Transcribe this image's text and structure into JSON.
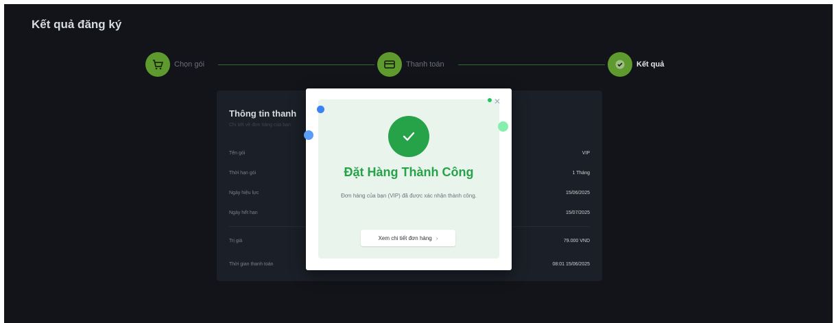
{
  "page": {
    "title": "Kết quả đăng ký"
  },
  "stepper": {
    "steps": [
      {
        "label": "Chọn gói",
        "icon": "cart-icon",
        "state": "done"
      },
      {
        "label": "Thanh toán",
        "icon": "card-icon",
        "state": "done"
      },
      {
        "label": "Kết quả",
        "icon": "check-icon",
        "state": "active"
      }
    ]
  },
  "info_card": {
    "title": "Thông tin thanh",
    "subtitle": "Chi tiết về đơn hàng của bạn",
    "rows": [
      {
        "label": "Tên gói",
        "value": "VIP"
      },
      {
        "label": "Thời hạn gói",
        "value": "1 Tháng"
      },
      {
        "label": "Ngày hiệu lực",
        "value": "15/06/2025"
      },
      {
        "label": "Ngày hết hạn",
        "value": "15/07/2025"
      },
      {
        "label": "Trị giá",
        "value": "79.000 VND"
      },
      {
        "label": "Thời gian thanh toán",
        "value": "08:01 15/06/2025"
      }
    ]
  },
  "modal": {
    "heading": "Đặt Hàng Thành Công",
    "description": "Đơn hàng của bạn (VIP) đã được xác nhận thành công.",
    "detail_button": "Xem chi tiết đơn hàng",
    "close_icon": "close-icon",
    "success_icon": "checkmark-icon"
  },
  "colors": {
    "app_bg": "#121419",
    "card_bg": "#1b1f27",
    "step_green": "#5e9a2e",
    "success_green": "#26a248",
    "confetti_blue": "#3b82f6",
    "confetti_mint": "#86efac"
  }
}
